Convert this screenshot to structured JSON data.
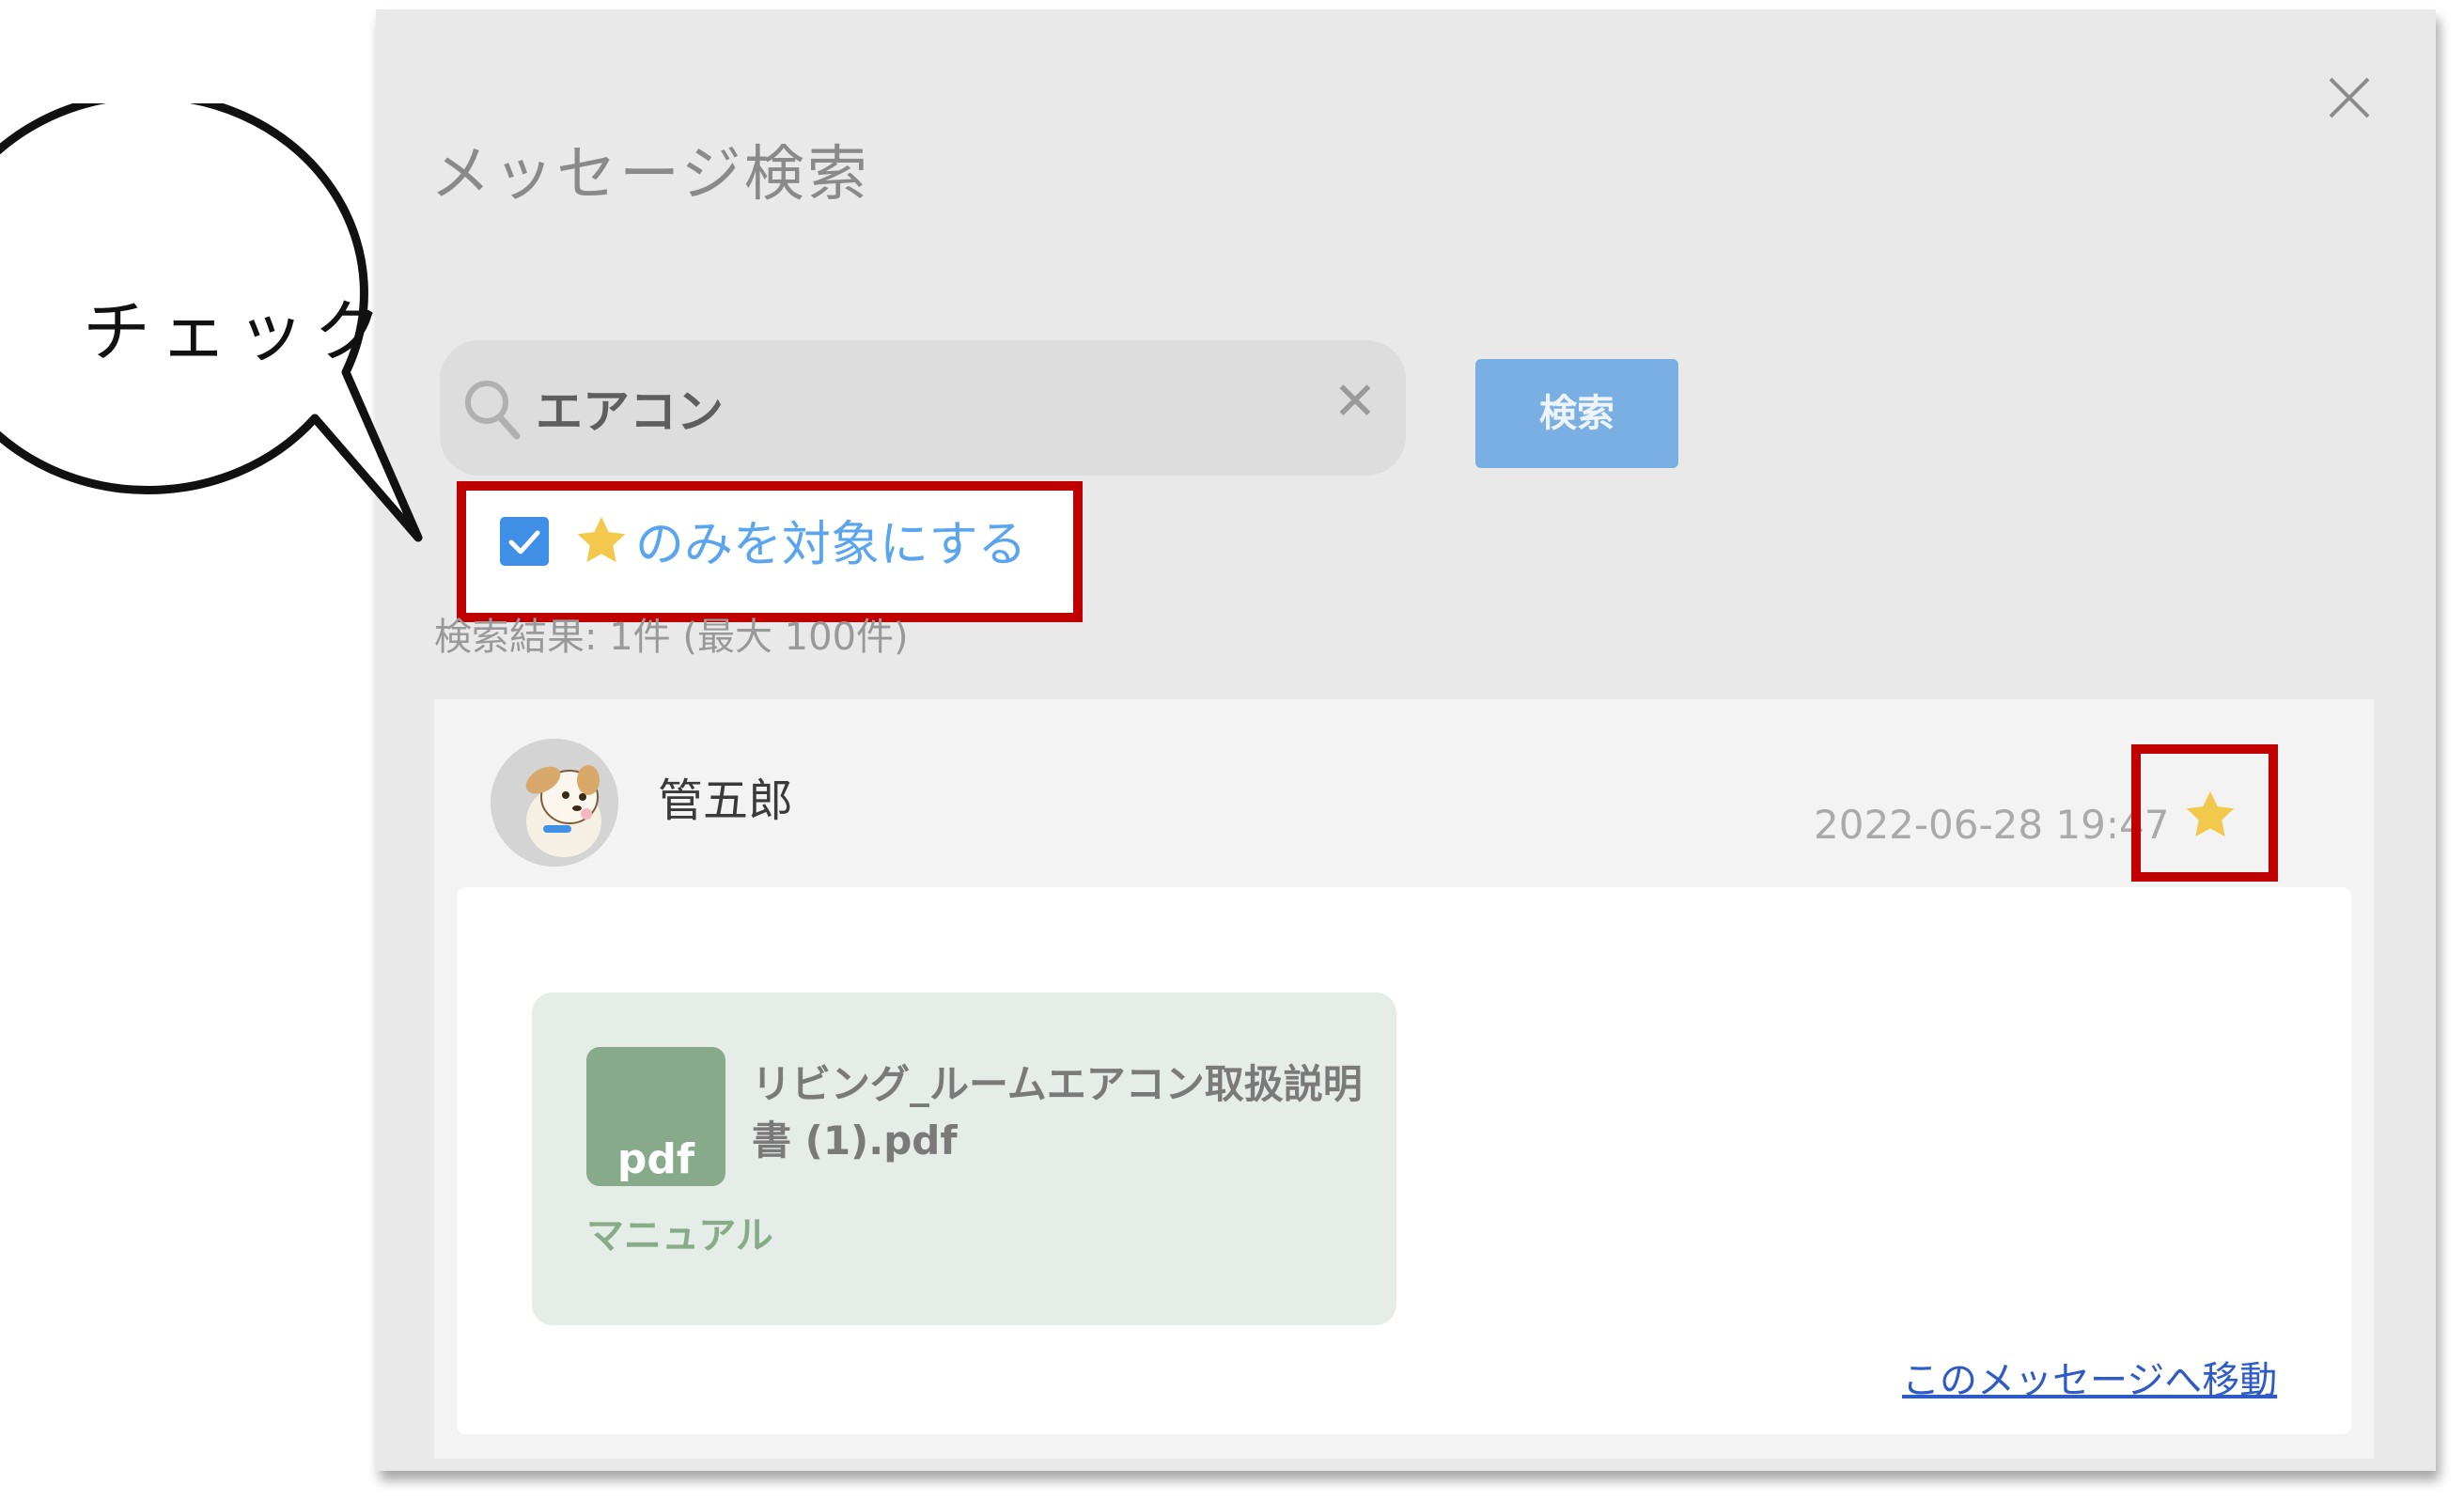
{
  "dialog": {
    "title": "メッセージ検索"
  },
  "search": {
    "value": "エアコン",
    "placeholder": "",
    "button_label": "検索"
  },
  "filter": {
    "checked": true,
    "label": "のみを対象にする"
  },
  "results": {
    "count_text": "検索結果: 1件 (最大 100件)",
    "items": [
      {
        "sender": "管五郎",
        "timestamp": "2022-06-28 19:47",
        "starred": true,
        "attachment": {
          "type_label": "pdf",
          "file_name": "リビング_ルームエアコン取扱説明書 (1).pdf",
          "tag": "マニュアル"
        },
        "link_label": "このメッセージへ移動"
      }
    ]
  },
  "callout": {
    "text": "チェック"
  },
  "colors": {
    "accent_blue": "#3f8fe6",
    "search_button": "#7aafe3",
    "highlight_red": "#c00000",
    "star_yellow": "#f2c94c",
    "pdf_green": "#86aa8a"
  },
  "icons": [
    "close-icon",
    "search-icon",
    "clear-icon",
    "checkmark-icon",
    "star-icon",
    "pdf-file-icon"
  ]
}
